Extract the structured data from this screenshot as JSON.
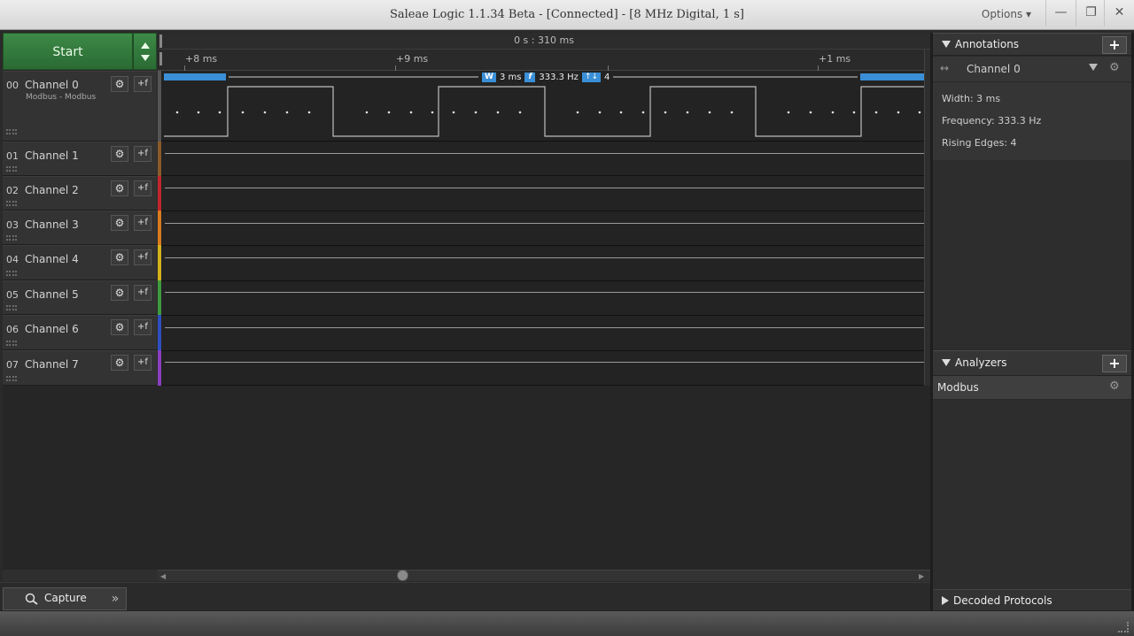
{
  "window": {
    "title": "Saleae Logic 1.1.34 Beta - [Connected] - [8 MHz Digital, 1 s]",
    "options_label": "Options ▾",
    "minimize": "—",
    "restore": "❐",
    "close": "✕"
  },
  "start_button": {
    "label": "Start"
  },
  "channels": [
    {
      "num": "00",
      "name": "Channel 0",
      "sub": "Modbus - Modbus",
      "color": "#555555"
    },
    {
      "num": "01",
      "name": "Channel 1",
      "sub": "",
      "color": "#8b5a2b"
    },
    {
      "num": "02",
      "name": "Channel 2",
      "sub": "",
      "color": "#c0282d"
    },
    {
      "num": "03",
      "name": "Channel 3",
      "sub": "",
      "color": "#d87a1e"
    },
    {
      "num": "04",
      "name": "Channel 4",
      "sub": "",
      "color": "#d4b21c"
    },
    {
      "num": "05",
      "name": "Channel 5",
      "sub": "",
      "color": "#3e9b3e"
    },
    {
      "num": "06",
      "name": "Channel 6",
      "sub": "",
      "color": "#2f4fc0"
    },
    {
      "num": "07",
      "name": "Channel 7",
      "sub": "",
      "color": "#8a3fc0"
    }
  ],
  "timeline": {
    "center_label": "0 s : 310 ms",
    "ticks": [
      "+8 ms",
      "+9 ms",
      "+1 ms"
    ]
  },
  "measurement": {
    "width_badge": "W",
    "width_value": "3 ms",
    "freq_badge": "f",
    "freq_value": "333.3 Hz",
    "edges_badge": "↑↓",
    "edges_value": "4"
  },
  "annotations": {
    "header": "Annotations",
    "add": "+",
    "channel_label": "Channel 0",
    "width": "Width: 3 ms",
    "frequency": "Frequency: 333.3 Hz",
    "rising_edges": "Rising Edges: 4"
  },
  "analyzers": {
    "header": "Analyzers",
    "add": "+",
    "items": [
      "Modbus"
    ]
  },
  "decoded": {
    "header": "Decoded Protocols"
  },
  "capture_tab": {
    "label": "Capture"
  },
  "icons": {
    "gear": "⚙",
    "trigger": "+f",
    "search": "search-icon",
    "expand": "»"
  }
}
